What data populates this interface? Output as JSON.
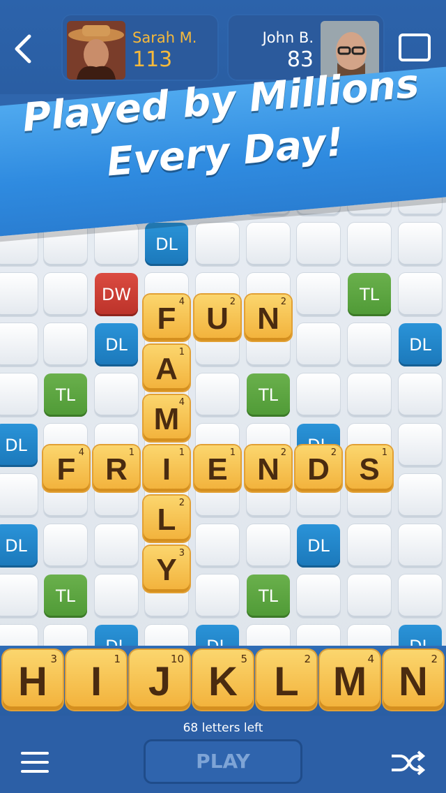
{
  "header": {
    "player1": {
      "name": "Sarah M.",
      "score": "113"
    },
    "player2": {
      "name": "John B.",
      "score": "83"
    }
  },
  "banner": {
    "line1": "Played by Millions",
    "line2": "Every Day!"
  },
  "bonus_labels": {
    "dl": "DL",
    "tl": "TL",
    "dw": "DW"
  },
  "board_tiles": [
    {
      "letter": "F",
      "value": "4"
    },
    {
      "letter": "U",
      "value": "2"
    },
    {
      "letter": "N",
      "value": "2"
    },
    {
      "letter": "A",
      "value": "1"
    },
    {
      "letter": "M",
      "value": "4"
    },
    {
      "letter": "F",
      "value": "4"
    },
    {
      "letter": "R",
      "value": "1"
    },
    {
      "letter": "I",
      "value": "1"
    },
    {
      "letter": "E",
      "value": "1"
    },
    {
      "letter": "N",
      "value": "2"
    },
    {
      "letter": "D",
      "value": "2"
    },
    {
      "letter": "S",
      "value": "1"
    },
    {
      "letter": "L",
      "value": "2"
    },
    {
      "letter": "Y",
      "value": "3"
    }
  ],
  "rack": [
    {
      "letter": "H",
      "value": "3"
    },
    {
      "letter": "I",
      "value": "1"
    },
    {
      "letter": "J",
      "value": "10"
    },
    {
      "letter": "K",
      "value": "5"
    },
    {
      "letter": "L",
      "value": "2"
    },
    {
      "letter": "M",
      "value": "4"
    },
    {
      "letter": "N",
      "value": "2"
    }
  ],
  "footer": {
    "letters_left": "68 letters left",
    "play_label": "PLAY"
  },
  "icons": {
    "back": "chevron-left-icon",
    "chat": "chat-icon",
    "menu": "menu-icon",
    "shuffle": "shuffle-icon"
  },
  "colors": {
    "dl": "#1f86cc",
    "tl": "#5ea743",
    "dw": "#cc3d34",
    "tile": "#f6c453",
    "score_accent": "#f6b93b"
  }
}
